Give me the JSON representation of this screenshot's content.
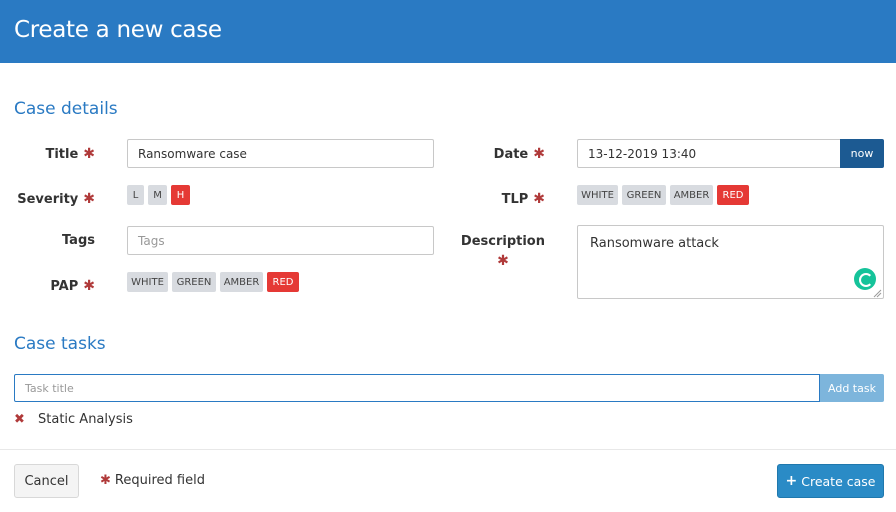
{
  "header": {
    "title": "Create a new case"
  },
  "details": {
    "section_title": "Case details",
    "title_label": "Title",
    "title_value": "Ransomware case",
    "severity_label": "Severity",
    "severity_options": [
      "L",
      "M",
      "H"
    ],
    "severity_selected": "H",
    "tags_label": "Tags",
    "tags_placeholder": "Tags",
    "pap_label": "PAP",
    "pap_options": [
      "WHITE",
      "GREEN",
      "AMBER",
      "RED"
    ],
    "pap_selected": "RED",
    "date_label": "Date",
    "date_value": "13-12-2019 13:40",
    "now_label": "now",
    "tlp_label": "TLP",
    "tlp_options": [
      "WHITE",
      "GREEN",
      "AMBER",
      "RED"
    ],
    "tlp_selected": "RED",
    "description_label": "Description",
    "description_value": "Ransomware attack",
    "required_mark": "✱"
  },
  "tasks": {
    "section_title": "Case tasks",
    "input_placeholder": "Task title",
    "add_label": "Add task",
    "items": [
      "Static Analysis"
    ],
    "remove_mark": "✖"
  },
  "footer": {
    "cancel_label": "Cancel",
    "required_note": "Required field",
    "create_label": "Create case",
    "create_plus": "+"
  },
  "colors": {
    "header": "#2a7ac3",
    "selected_pill": "#e53935",
    "required": "#b03a3a"
  }
}
